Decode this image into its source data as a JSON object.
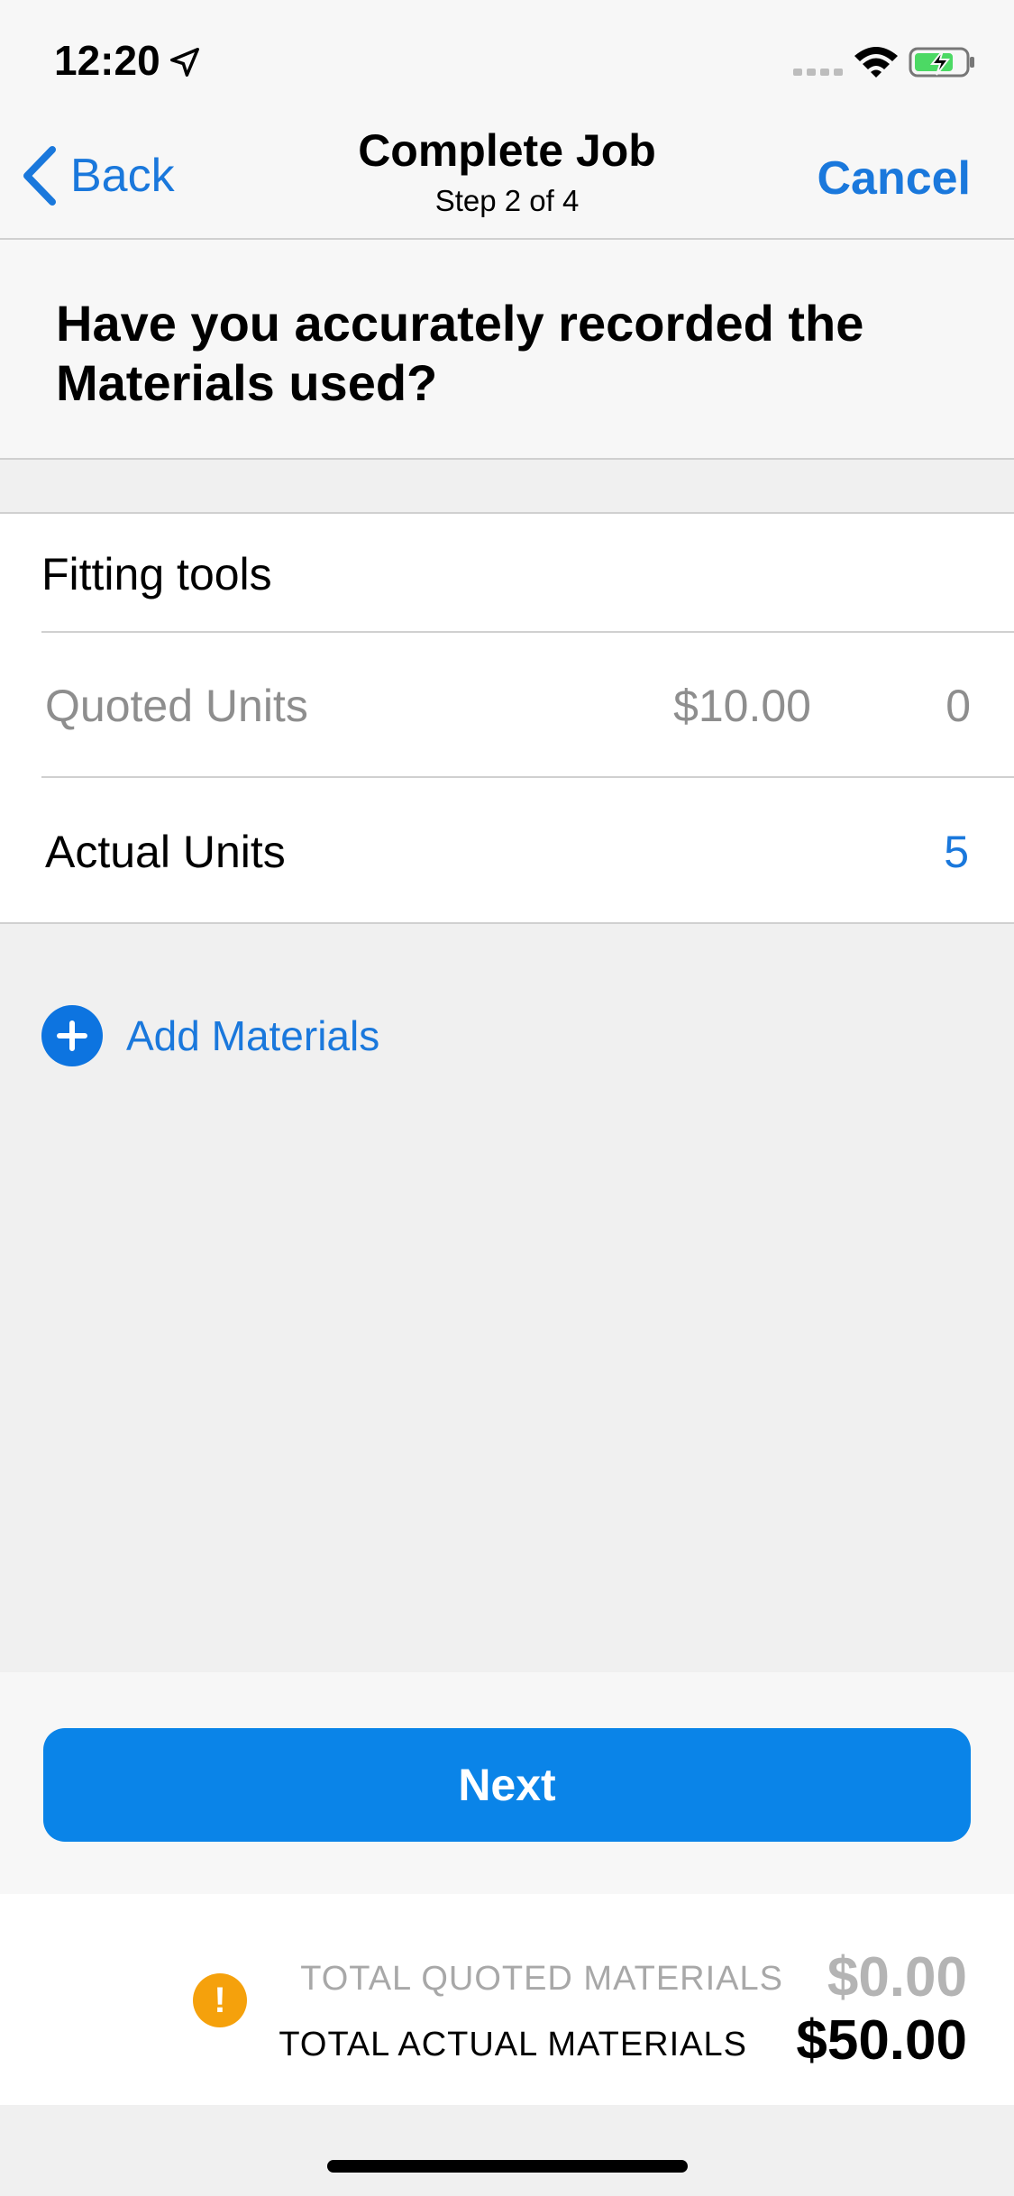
{
  "status_bar": {
    "time": "12:20",
    "icons": [
      "location-arrow-icon",
      "signal-icon",
      "wifi-icon",
      "battery-charging-icon"
    ]
  },
  "nav": {
    "back_label": "Back",
    "title": "Complete Job",
    "subtitle": "Step 2 of 4",
    "cancel_label": "Cancel"
  },
  "question": "Have you accurately recorded the Materials used?",
  "material": {
    "name": "Fitting tools",
    "quoted_label": "Quoted Units",
    "quoted_price": "$10.00",
    "quoted_qty": "0",
    "actual_label": "Actual Units",
    "actual_qty": "5"
  },
  "add_materials_label": "Add Materials",
  "next_label": "Next",
  "totals": {
    "quoted_label": "TOTAL QUOTED MATERIALS",
    "quoted_value": "$0.00",
    "actual_label": "TOTAL ACTUAL MATERIALS",
    "actual_value": "$50.00",
    "warning_glyph": "!"
  },
  "colors": {
    "accent": "#1a78dc",
    "button": "#0a84e8",
    "warning": "#f5a10c"
  }
}
